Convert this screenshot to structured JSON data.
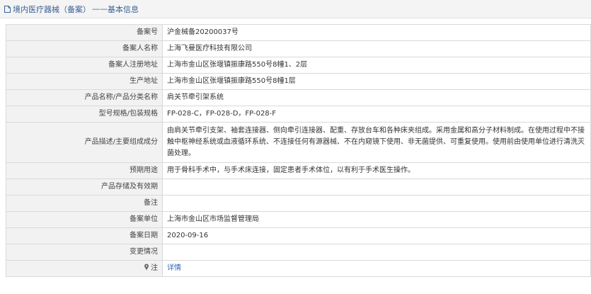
{
  "header": {
    "title": "境内医疗器械（备案）",
    "separator": "——",
    "subtitle": "基本信息"
  },
  "rows": [
    {
      "label": "备案号",
      "value": "沪金械备20200037号"
    },
    {
      "label": "备案人名称",
      "value": "上海飞曼医疗科技有限公司"
    },
    {
      "label": "备案人注册地址",
      "value": "上海市金山区张堰镇振康路550号8幢1、2层"
    },
    {
      "label": "生产地址",
      "value": "上海市金山区张堰镇振康路550号8幢1层"
    },
    {
      "label": "产品名称/产品分类名称",
      "value": "肩关节牵引架系统"
    },
    {
      "label": "型号规格/包装规格",
      "value": "FP-028-C，FP-028-D，FP-028-F"
    },
    {
      "label": "产品描述/主要组成成分",
      "value": "由肩关节牵引支架、袖套连接器、侧向牵引连接器、配重、存放台车和各种床夹组成。采用金属和高分子材料制成。在使用过程中不接触中枢神经系统或血液循环系统、不连接任何有源器械、不在内窥镜下使用、非无菌提供、可重复使用。使用前由使用单位进行清洗灭菌处理。"
    },
    {
      "label": "预期用途",
      "value": "用于骨科手术中，与手术床连接，固定患者手术体位，以有利于手术医生操作。"
    },
    {
      "label": "产品存储及有效期",
      "value": ""
    },
    {
      "label": "备注",
      "value": ""
    },
    {
      "label": "备案单位",
      "value": "上海市金山区市场监督管理局"
    },
    {
      "label": "备案日期",
      "value": "2020-09-16"
    },
    {
      "label": "变更情况",
      "value": ""
    },
    {
      "label": "注",
      "value": "详情"
    }
  ],
  "icons": {
    "header_icon": "document-icon",
    "note_icon": "pin-icon"
  },
  "colors": {
    "title": "#3a5f95",
    "link": "#2f63b7",
    "label_bg": "#f2f2f2",
    "border": "#d9d9d9"
  }
}
